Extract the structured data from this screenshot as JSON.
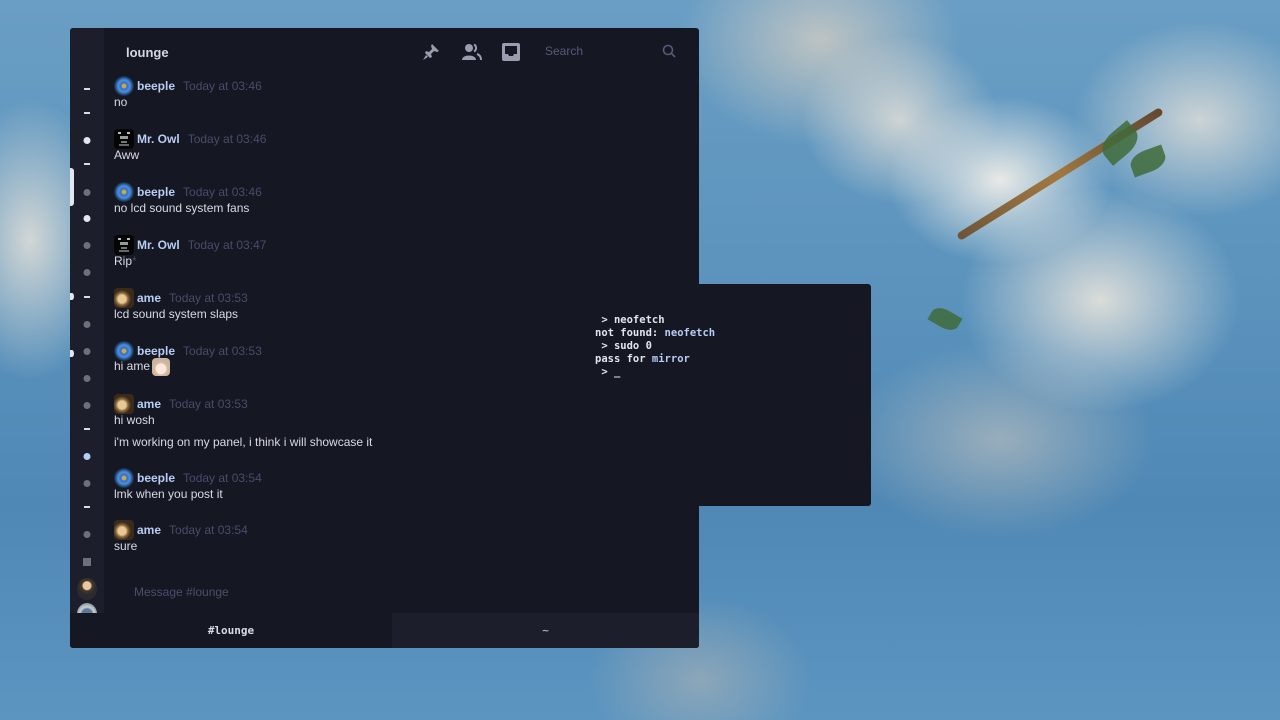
{
  "wallpaper": {
    "subject": "cherry-blossom-branch",
    "sky_color": "#5b93bd"
  },
  "chat": {
    "channel_title": "lounge",
    "toolbar": {
      "pin_icon": "pin-icon",
      "members_icon": "members-icon",
      "inbox_icon": "inbox-icon",
      "search_placeholder": "Search",
      "search_icon": "search-icon"
    },
    "rail": [
      "dash",
      "dash",
      "dot-active",
      "dash",
      "dot",
      "dot-active",
      "dot",
      "dot",
      "dash",
      "dot",
      "dot",
      "dot",
      "dot",
      "dash",
      "dot-blue",
      "dot",
      "dash",
      "dot",
      "square",
      "avatar-user",
      "avatar-user2"
    ],
    "messages": [
      {
        "author": "beeple",
        "avatar": "beeple",
        "time": "Today at 03:46",
        "lines": [
          "no"
        ]
      },
      {
        "author": "Mr. Owl",
        "avatar": "owl",
        "time": "Today at 03:46",
        "lines": [
          "Aww"
        ]
      },
      {
        "author": "beeple",
        "avatar": "beeple",
        "time": "Today at 03:46",
        "lines": [
          "no lcd sound system fans"
        ]
      },
      {
        "author": "Mr. Owl",
        "avatar": "owl",
        "time": "Today at 03:47",
        "lines": [
          "Rip"
        ],
        "edited_mark": "*"
      },
      {
        "author": "ame",
        "avatar": "ame",
        "time": "Today at 03:53",
        "lines": [
          "lcd sound system slaps"
        ]
      },
      {
        "author": "beeple",
        "avatar": "beeple",
        "time": "Today at 03:53",
        "lines": [
          "hi ame"
        ],
        "emoji": "ame-emoji"
      },
      {
        "author": "ame",
        "avatar": "ame",
        "time": "Today at 03:53",
        "lines": [
          "hi wosh",
          "i'm working on my panel, i think i will showcase it"
        ]
      },
      {
        "author": "beeple",
        "avatar": "beeple",
        "time": "Today at 03:54",
        "lines": [
          "lmk when you post it"
        ]
      },
      {
        "author": "ame",
        "avatar": "ame",
        "time": "Today at 03:54",
        "lines": [
          "sure"
        ]
      }
    ],
    "composer_placeholder": "Message #lounge",
    "tabs": [
      {
        "label": "#lounge",
        "active": true
      },
      {
        "label": "~",
        "active": false
      }
    ],
    "colors": {
      "accent": "#b8cdf5",
      "background": "#151722",
      "rail": "#1c1f2b",
      "muted": "#484c6a"
    }
  },
  "terminal": {
    "lines": [
      {
        "prefix": " > ",
        "text": "neofetch",
        "highlight": ""
      },
      {
        "prefix": "",
        "text": "not found: ",
        "highlight": "neofetch"
      },
      {
        "prefix": " > ",
        "text": "sudo 0",
        "highlight": ""
      },
      {
        "prefix": "",
        "text": "pass for ",
        "highlight": "mirror"
      },
      {
        "prefix": " > ",
        "text": "_",
        "highlight": ""
      }
    ]
  }
}
